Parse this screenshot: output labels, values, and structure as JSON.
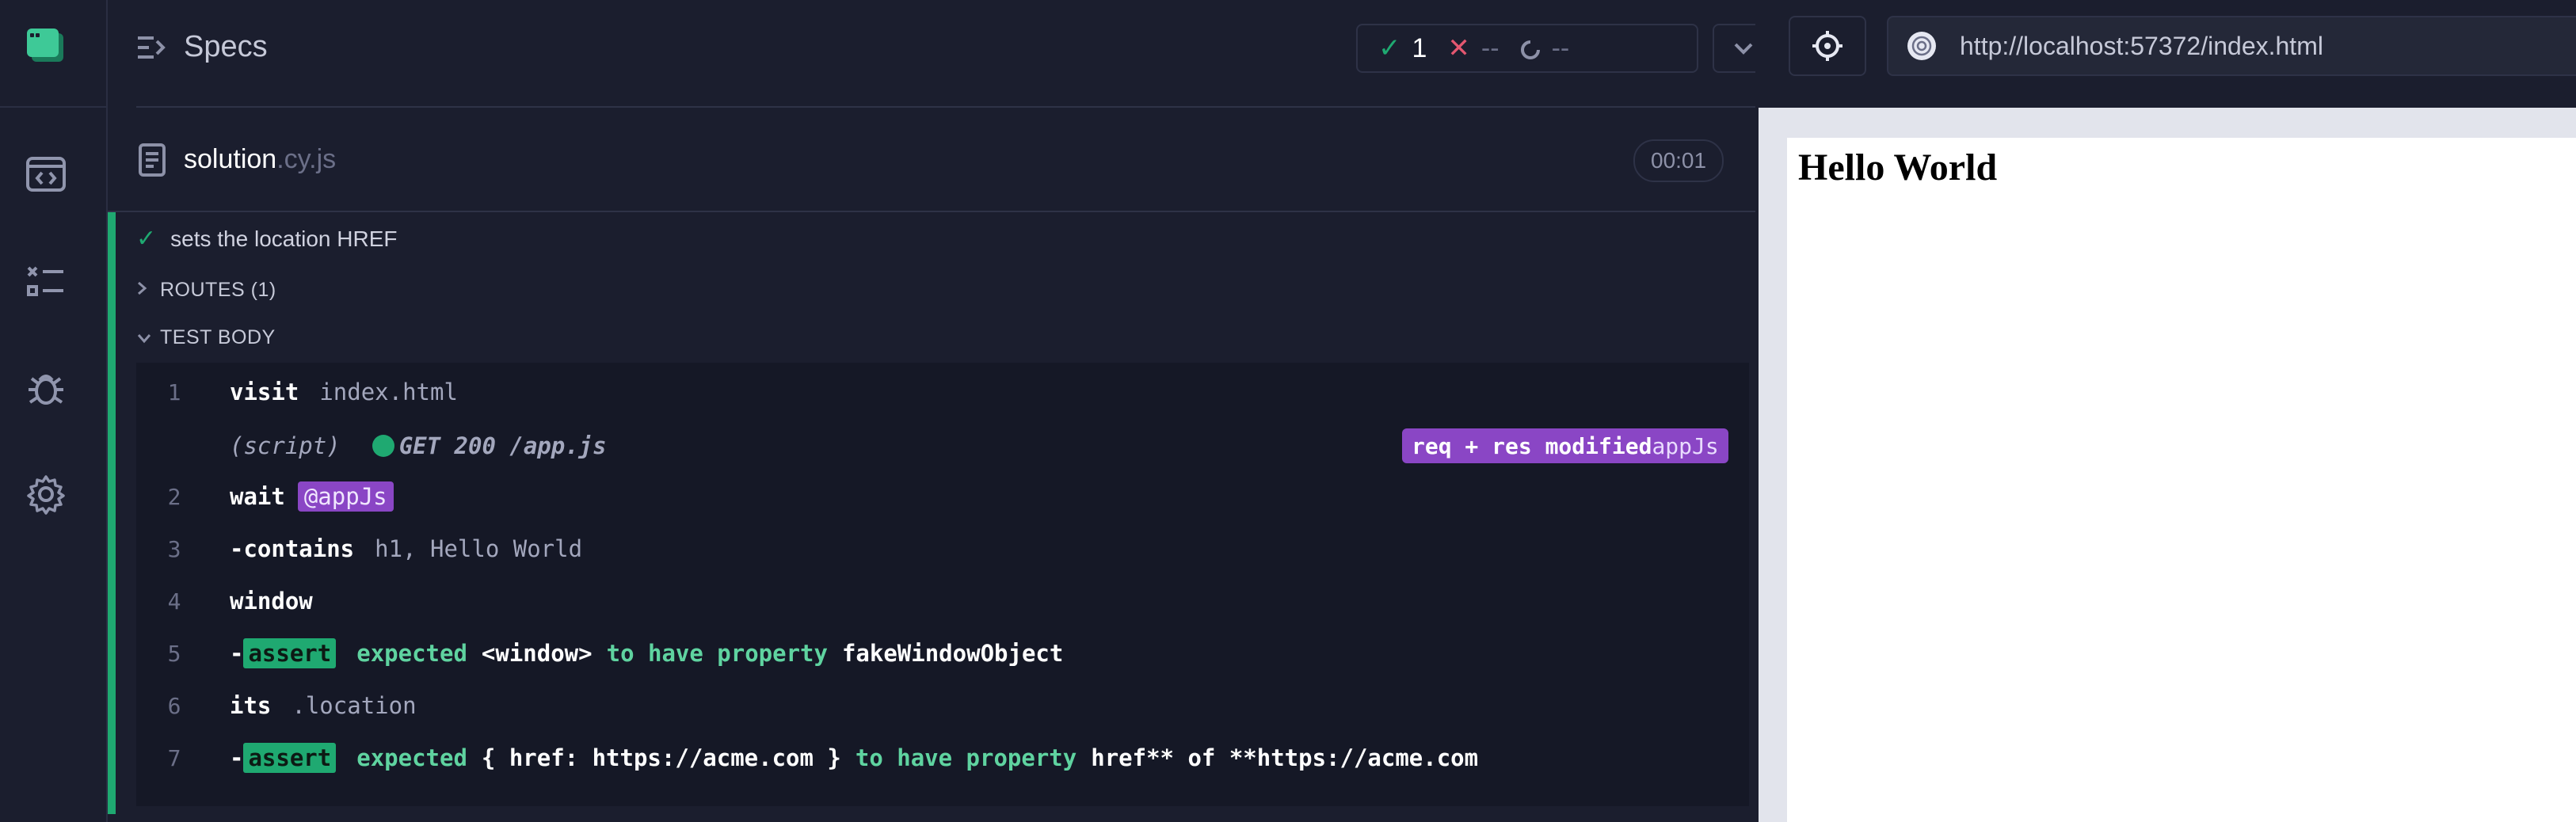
{
  "reporter": {
    "header_title": "Specs",
    "stats": {
      "passed": "1",
      "failed": "--",
      "pending": "--"
    },
    "spec_file": {
      "name": "solution",
      "ext": ".cy.js",
      "duration": "00:01"
    },
    "test": {
      "title": "sets the location HREF",
      "routes_label": "ROUTES (1)",
      "body_label": "TEST BODY",
      "commands": [
        {
          "num": "1",
          "name": "visit",
          "arg": "index.html"
        },
        {
          "num": "",
          "script_label": "(script)",
          "request": "GET 200 /app.js",
          "badge_text": "req + res modified",
          "badge_alias": "appJs"
        },
        {
          "num": "2",
          "name": "wait",
          "alias": "@appJs"
        },
        {
          "num": "3",
          "dash": "-",
          "name": "contains",
          "arg": "h1, Hello World"
        },
        {
          "num": "4",
          "name": "window"
        },
        {
          "num": "5",
          "dash": "-",
          "assert": "assert",
          "parts": [
            "expected",
            "<window>",
            "to have property",
            "fakeWindowObject"
          ]
        },
        {
          "num": "6",
          "name": "its",
          "arg": ".location"
        },
        {
          "num": "7",
          "dash": "-",
          "assert": "assert",
          "parts": [
            "expected",
            "{ href: https://acme.com }",
            "to have property",
            "href** of **https://acme.com"
          ]
        }
      ]
    }
  },
  "aut": {
    "url": "http://localhost:57372/index.html",
    "page_heading": "Hello World"
  },
  "icons": {
    "rail": [
      "app-logo-icon",
      "specs-icon",
      "runs-icon",
      "debug-icon",
      "settings-icon"
    ]
  },
  "colors": {
    "pass": "#1fa971",
    "alias": "#8a46c5",
    "fail": "#e45770",
    "background": "#1b1e2e"
  }
}
